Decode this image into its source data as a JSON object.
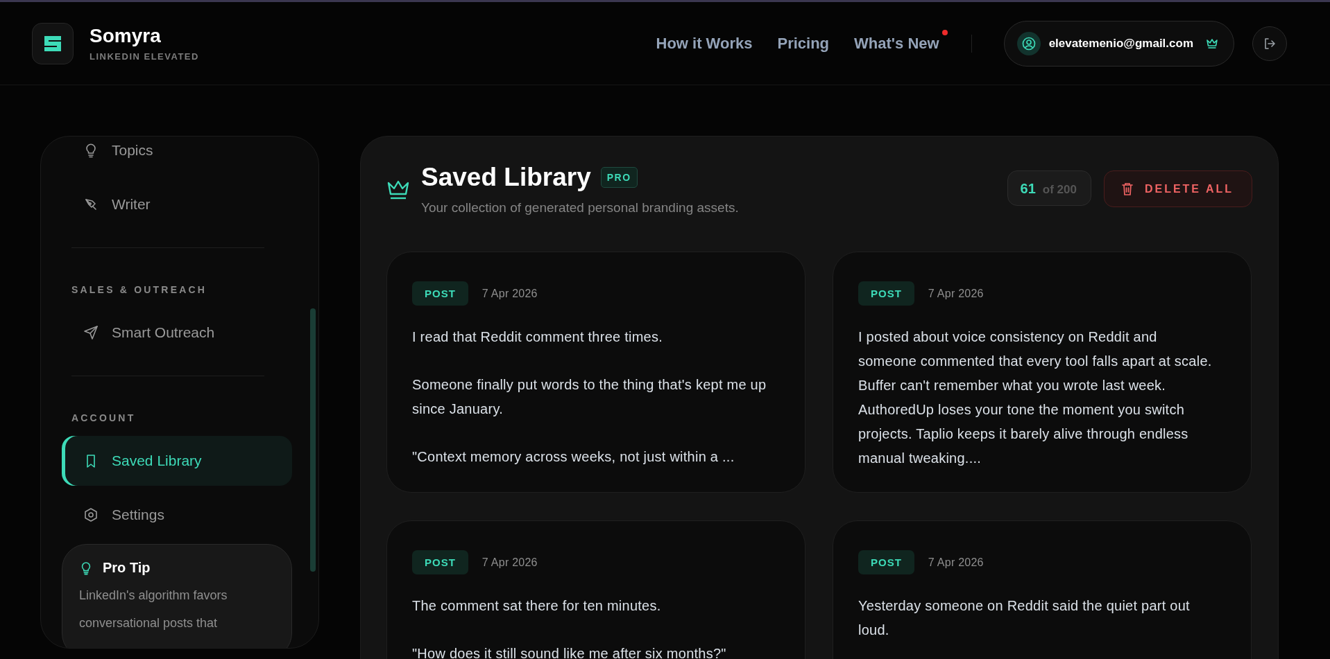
{
  "brand": {
    "name": "Somyra",
    "tagline": "LINKEDIN ELEVATED"
  },
  "nav": [
    {
      "label": "How it Works",
      "badge": false
    },
    {
      "label": "Pricing",
      "badge": false
    },
    {
      "label": "What's New",
      "badge": true
    }
  ],
  "account": {
    "email": "elevatemenio@gmail.com",
    "pro": true
  },
  "sidebar": {
    "groups": [
      {
        "items": [
          {
            "label": "Topics",
            "selected": false
          },
          {
            "label": "Writer",
            "selected": false
          }
        ]
      },
      {
        "label": "SALES & OUTREACH",
        "items": [
          {
            "label": "Smart Outreach",
            "selected": false
          }
        ]
      },
      {
        "label": "ACCOUNT",
        "items": [
          {
            "label": "Saved Library",
            "selected": true
          },
          {
            "label": "Settings",
            "selected": false
          }
        ]
      }
    ],
    "tip": {
      "title": "Pro Tip",
      "text": "LinkedIn's algorithm favors conversational posts that"
    }
  },
  "library": {
    "title": "Saved Library",
    "badge": "PRO",
    "subtitle": "Your collection of generated personal branding assets.",
    "count": "61",
    "limit": "of 200",
    "delete_label": "DELETE ALL",
    "cards": [
      {
        "type": "POST",
        "date": "7 Apr 2026",
        "paragraphs": [
          "I read that Reddit comment three times.",
          "Someone finally put words to the thing that's kept me up since January.",
          "\"Context memory across weeks, not just within a ..."
        ]
      },
      {
        "type": "POST",
        "date": "7 Apr 2026",
        "paragraphs": [
          "I posted about voice consistency on Reddit and someone commented that every tool falls apart at scale. Buffer can't remember what you wrote last week. AuthoredUp loses your tone the moment you switch projects. Taplio keeps it barely alive through endless manual tweaking...."
        ]
      },
      {
        "type": "POST",
        "date": "7 Apr 2026",
        "paragraphs": [
          "The comment sat there for ten minutes.",
          "\"How does it still sound like me after six months?\""
        ]
      },
      {
        "type": "POST",
        "date": "7 Apr 2026",
        "paragraphs": [
          "Yesterday someone on Reddit said the quiet part out loud."
        ]
      }
    ]
  }
}
